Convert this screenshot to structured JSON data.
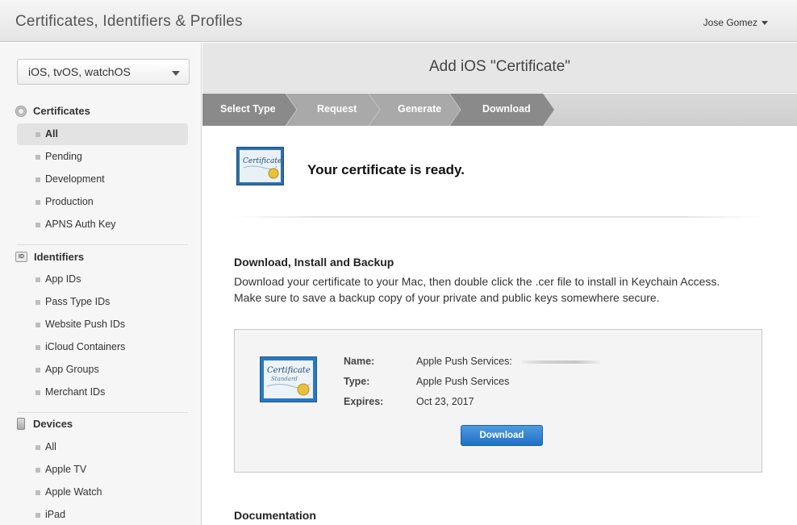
{
  "header": {
    "title": "Certificates, Identifiers & Profiles",
    "user_name": "Jose Gomez"
  },
  "sidebar": {
    "platform_select": "iOS, tvOS, watchOS",
    "sections": [
      {
        "title": "Certificates",
        "icon": "certificate-seal-icon",
        "items": [
          "All",
          "Pending",
          "Development",
          "Production",
          "APNS Auth Key"
        ],
        "active_index": 0
      },
      {
        "title": "Identifiers",
        "icon": "id-badge-icon",
        "icon_text": "ID",
        "items": [
          "App IDs",
          "Pass Type IDs",
          "Website Push IDs",
          "iCloud Containers",
          "App Groups",
          "Merchant IDs"
        ]
      },
      {
        "title": "Devices",
        "icon": "phone-device-icon",
        "items": [
          "All",
          "Apple TV",
          "Apple Watch",
          "iPad"
        ]
      }
    ]
  },
  "main": {
    "page_title": "Add iOS \"Certificate\"",
    "steps": [
      "Select Type",
      "Request",
      "Generate",
      "Download"
    ],
    "current_step": 3,
    "ready_message": "Your certificate is ready.",
    "certificate_icon_text": "Certificate",
    "download_section": {
      "title": "Download, Install and Backup",
      "description": "Download your certificate to your Mac, then double click the .cer file to install in Keychain Access. Make sure to save a backup copy of your private and public keys somewhere secure."
    },
    "certificate": {
      "icon_title": "Certificate",
      "icon_subtitle": "Standard",
      "name_label": "Name:",
      "name_value": "Apple Push Services:",
      "type_label": "Type:",
      "type_value": "Apple Push Services",
      "expires_label": "Expires:",
      "expires_value": "Oct 23, 2017",
      "download_button": "Download"
    },
    "documentation_title": "Documentation"
  },
  "colors": {
    "accent_blue": "#2a78cc",
    "step_active": "#8a8a8a",
    "step_inactive": "#a9a9a9"
  }
}
